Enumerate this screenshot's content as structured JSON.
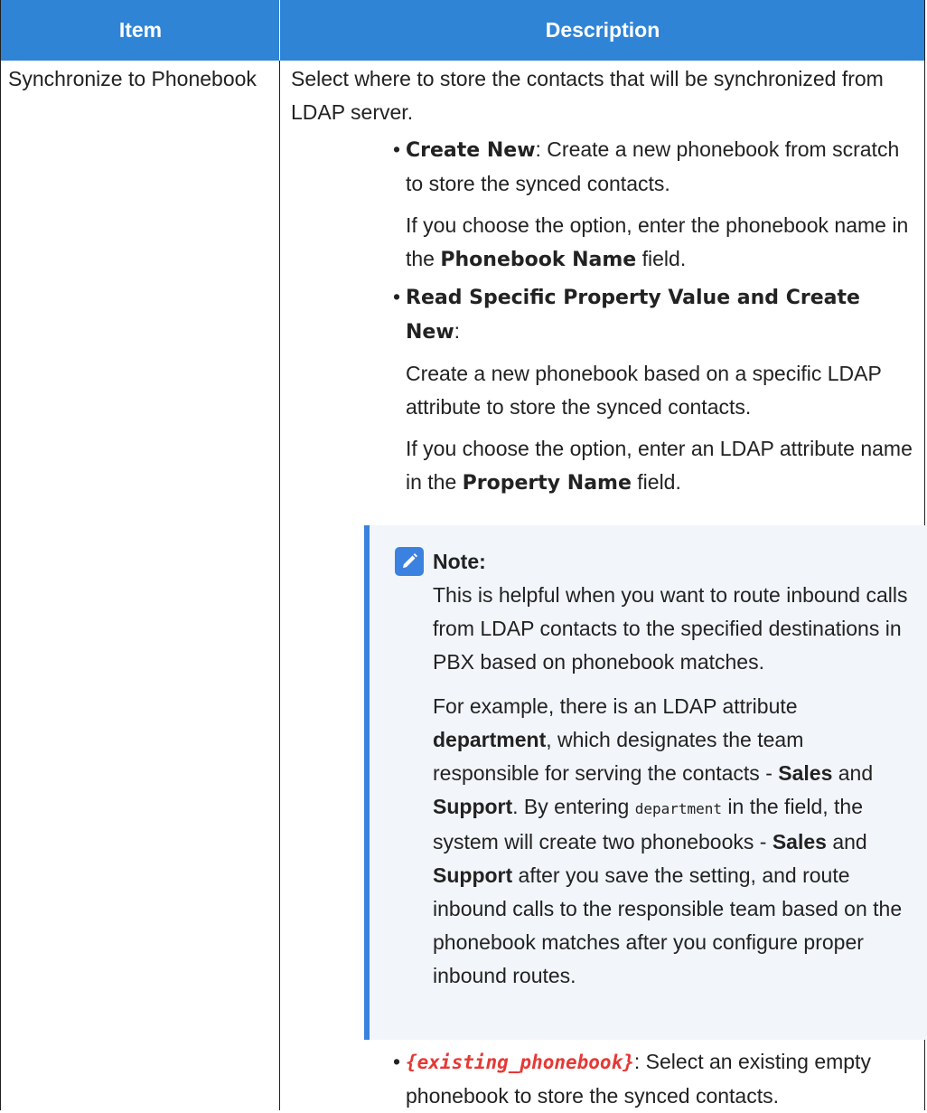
{
  "header": {
    "item_label": "Item",
    "description_label": "Description"
  },
  "row": {
    "item": "Synchronize to Phonebook",
    "intro": "Select where to store the contacts that will be synchronized from LDAP server.",
    "options": [
      {
        "title": "Create New",
        "text": ": Create a new phonebook from scratch to store the synced contacts.",
        "sub_pre": "If you choose the option, enter the phonebook name in the ",
        "sub_bold": "Phonebook Name",
        "sub_post": " field."
      },
      {
        "title": "Read Specific Property Value and Create New",
        "text": ":",
        "para1": "Create a new phonebook based on a specific LDAP attribute to store the synced contacts.",
        "sub_pre": "If you choose the option, enter an LDAP attribute name in the ",
        "sub_bold": "Property Name",
        "sub_post": " field."
      },
      {
        "var": "{existing_phonebook}",
        "text": ": Select an existing empty phonebook to store the synced contacts."
      }
    ],
    "note": {
      "title": "Note:",
      "p1": "This is helpful when you want to route inbound calls from LDAP contacts to the specified destinations in PBX based on phonebook matches.",
      "p2_a": "For example, there is an LDAP attribute ",
      "p2_b": "department",
      "p2_c": ", which designates the team responsible for serving the contacts - ",
      "p2_d": "Sales",
      "p2_e": " and ",
      "p2_f": "Support",
      "p2_g": ". By entering ",
      "p2_code": "department",
      "p2_h": " in the field, the system will create two phonebooks - ",
      "p2_i": "Sales",
      "p2_j": " and ",
      "p2_k": "Support",
      "p2_l": " after you save the setting, and route inbound calls to the responsible team based on the phonebook matches after you configure proper inbound routes."
    }
  },
  "colors": {
    "header_bg": "#2f84d6",
    "note_bg": "#f2f6fa",
    "note_border": "#3b82e0",
    "variable": "#e53935"
  },
  "icons": {
    "note": "edit-note-icon"
  }
}
